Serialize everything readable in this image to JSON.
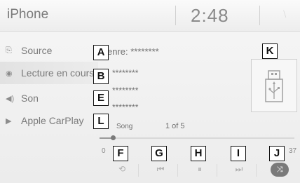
{
  "header": {
    "title": "iPhone",
    "clock": "2:48"
  },
  "sidebar": {
    "items": [
      {
        "label": "Source",
        "icon": "source-icon"
      },
      {
        "label": "Lecture en cours",
        "icon": "now-playing-icon"
      },
      {
        "label": "Son",
        "icon": "speaker-icon"
      },
      {
        "label": "Apple CarPlay",
        "icon": "carplay-icon"
      }
    ]
  },
  "track_info": {
    "genre": "enre: ********",
    "line2": "********",
    "line3": "********",
    "line4": "********",
    "song_label": "Song",
    "position": "1 of 5"
  },
  "progress": {
    "elapsed": "0",
    "total": "37",
    "fraction": 0.07
  },
  "labels": [
    "A",
    "B",
    "E",
    "L",
    "K",
    "F",
    "G",
    "H",
    "I",
    "J"
  ],
  "controls": {
    "repeat": "⟲",
    "previous": "⏮",
    "pause": "⏸",
    "next": "⏭",
    "shuffle": "⤨"
  }
}
